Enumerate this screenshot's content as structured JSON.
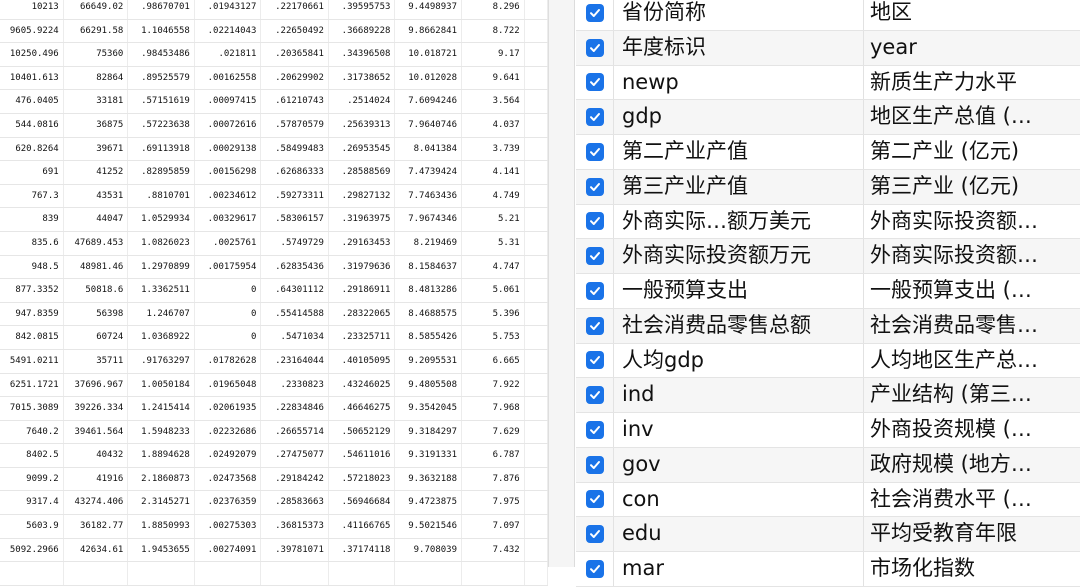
{
  "colors": {
    "checkbox_fill": "#1a73e8",
    "row_stripe": "#f6f6f6"
  },
  "data_grid": {
    "rows": [
      [
        "10213",
        "66649.02",
        ".98670701",
        ".01943127",
        ".22170661",
        ".39595753",
        "9.4498937",
        "8.296"
      ],
      [
        "9605.9224",
        "66291.58",
        "1.1046558",
        ".02214043",
        ".22650492",
        ".36689228",
        "9.8662841",
        "8.722"
      ],
      [
        "10250.496",
        "75360",
        ".98453486",
        ".021811",
        ".20365841",
        ".34396508",
        "10.018721",
        "9.17"
      ],
      [
        "10401.613",
        "82864",
        ".89525579",
        ".00162558",
        ".20629902",
        ".31738652",
        "10.012028",
        "9.641"
      ],
      [
        "476.0405",
        "33181",
        ".57151619",
        ".00097415",
        ".61210743",
        ".2514024",
        "7.6094246",
        "3.564"
      ],
      [
        "544.0816",
        "36875",
        ".57223638",
        ".00072616",
        ".57870579",
        ".25639313",
        "7.9640746",
        "4.037"
      ],
      [
        "620.8264",
        "39671",
        ".69113918",
        ".00029138",
        ".58499483",
        ".26953545",
        "8.041384",
        "3.739"
      ],
      [
        "691",
        "41252",
        ".82895859",
        ".00156298",
        ".62686333",
        ".28588569",
        "7.4739424",
        "4.141"
      ],
      [
        "767.3",
        "43531",
        ".8810701",
        ".00234612",
        ".59273311",
        ".29827132",
        "7.7463436",
        "4.749"
      ],
      [
        "839",
        "44047",
        "1.0529934",
        ".00329617",
        ".58306157",
        ".31963975",
        "7.9674346",
        "5.21"
      ],
      [
        "835.6",
        "47689.453",
        "1.0826023",
        ".0025761",
        ".5749729",
        ".29163453",
        "8.219469",
        "5.31"
      ],
      [
        "948.5",
        "48981.46",
        "1.2970899",
        ".00175954",
        ".62835436",
        ".31979636",
        "8.1584637",
        "4.747"
      ],
      [
        "877.3352",
        "50818.6",
        "1.3362511",
        "0",
        ".64301112",
        ".29186911",
        "8.4813286",
        "5.061"
      ],
      [
        "947.8359",
        "56398",
        "1.246707",
        "0",
        ".55414588",
        ".28322065",
        "8.4688575",
        "5.396"
      ],
      [
        "842.0815",
        "60724",
        "1.0368922",
        "0",
        ".5471034",
        ".23325711",
        "8.5855426",
        "5.753"
      ],
      [
        "5491.0211",
        "35711",
        ".91763297",
        ".01782628",
        ".23164044",
        ".40105095",
        "9.2095531",
        "6.665"
      ],
      [
        "6251.1721",
        "37696.967",
        "1.0050184",
        ".01965048",
        ".2330823",
        ".43246025",
        "9.4805508",
        "7.922"
      ],
      [
        "7015.3089",
        "39226.334",
        "1.2415414",
        ".02061935",
        ".22834846",
        ".46646275",
        "9.3542045",
        "7.968"
      ],
      [
        "7640.2",
        "39461.564",
        "1.5948233",
        ".02232686",
        ".26655714",
        ".50652129",
        "9.3184297",
        "7.629"
      ],
      [
        "8402.5",
        "40432",
        "1.8894628",
        ".02492079",
        ".27475077",
        ".54611016",
        "9.3191331",
        "6.787"
      ],
      [
        "9099.2",
        "41916",
        "2.1860873",
        ".02473568",
        ".29184242",
        ".57218023",
        "9.3632188",
        "7.876"
      ],
      [
        "9317.4",
        "43274.406",
        "2.3145271",
        ".02376359",
        ".28583663",
        ".56946684",
        "9.4723875",
        "7.975"
      ],
      [
        "5603.9",
        "36182.77",
        "1.8850993",
        ".00275303",
        ".36815373",
        ".41166765",
        "9.5021546",
        "7.097"
      ],
      [
        "5092.2966",
        "42634.61",
        "1.9453655",
        ".00274091",
        ".39781071",
        ".37174118",
        "9.708039",
        "7.432"
      ],
      [
        "",
        "",
        "",
        "",
        "",
        "",
        "",
        ""
      ]
    ]
  },
  "variables": [
    {
      "name": "省份简称",
      "label": "地区"
    },
    {
      "name": "年度标识",
      "label": "year"
    },
    {
      "name": "newp",
      "label": "新质生产力水平"
    },
    {
      "name": "gdp",
      "label": "地区生产总值 (…"
    },
    {
      "name": "第二产业产值",
      "label": "第二产业 (亿元)"
    },
    {
      "name": "第三产业产值",
      "label": "第三产业 (亿元)"
    },
    {
      "name": "外商实际…额万美元",
      "label": "外商实际投资额…"
    },
    {
      "name": "外商实际投资额万元",
      "label": "外商实际投资额…"
    },
    {
      "name": "一般预算支出",
      "label": "一般预算支出 (…"
    },
    {
      "name": "社会消费品零售总额",
      "label": "社会消费品零售…"
    },
    {
      "name": "人均gdp",
      "label": "人均地区生产总…"
    },
    {
      "name": "ind",
      "label": "产业结构 (第三…"
    },
    {
      "name": "inv",
      "label": "外商投资规模 (…"
    },
    {
      "name": "gov",
      "label": "政府规模 (地方…"
    },
    {
      "name": "con",
      "label": "社会消费水平 (…"
    },
    {
      "name": "edu",
      "label": "平均受教育年限"
    },
    {
      "name": "mar",
      "label": "市场化指数"
    }
  ]
}
